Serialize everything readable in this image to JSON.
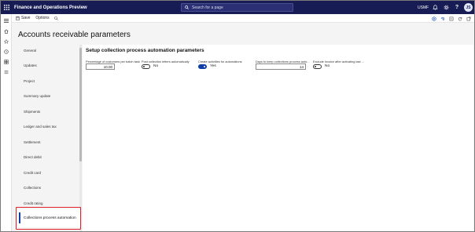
{
  "app": {
    "title": "Finance and Operations Preview",
    "search_placeholder": "Search for a page",
    "company": "USMF",
    "user_initials": "JS"
  },
  "actionbar": {
    "save_label": "Save",
    "options_label": "Options"
  },
  "page": {
    "title": "Accounts receivable parameters"
  },
  "sidebar": {
    "items": [
      {
        "label": "General"
      },
      {
        "label": "Updates"
      },
      {
        "label": "Project"
      },
      {
        "label": "Summary update"
      },
      {
        "label": "Shipments"
      },
      {
        "label": "Ledger and sales tax"
      },
      {
        "label": "Settlement"
      },
      {
        "label": "Direct debit"
      },
      {
        "label": "Credit card"
      },
      {
        "label": "Collections"
      },
      {
        "label": "Credit rating"
      }
    ],
    "selected": {
      "label": "Collections process automation"
    }
  },
  "main": {
    "section_title": "Setup collection process automation parameters",
    "fields": {
      "percent_customers": {
        "label": "Percentage of customers per batch task",
        "value": "10.00"
      },
      "post_letters": {
        "label": "Post collection letters automatically",
        "state": "No"
      },
      "create_activities": {
        "label": "Create activities for automations",
        "state": "Yes"
      },
      "days_keep": {
        "label": "Days to keep collections process auto...",
        "value": "14"
      },
      "exclude_invoice": {
        "label": "Exclude invoice after activating last ...",
        "state": "No"
      }
    }
  },
  "colors": {
    "topbar": "#171c54",
    "accent": "#0f3ea8",
    "highlight": "#e0202b"
  }
}
